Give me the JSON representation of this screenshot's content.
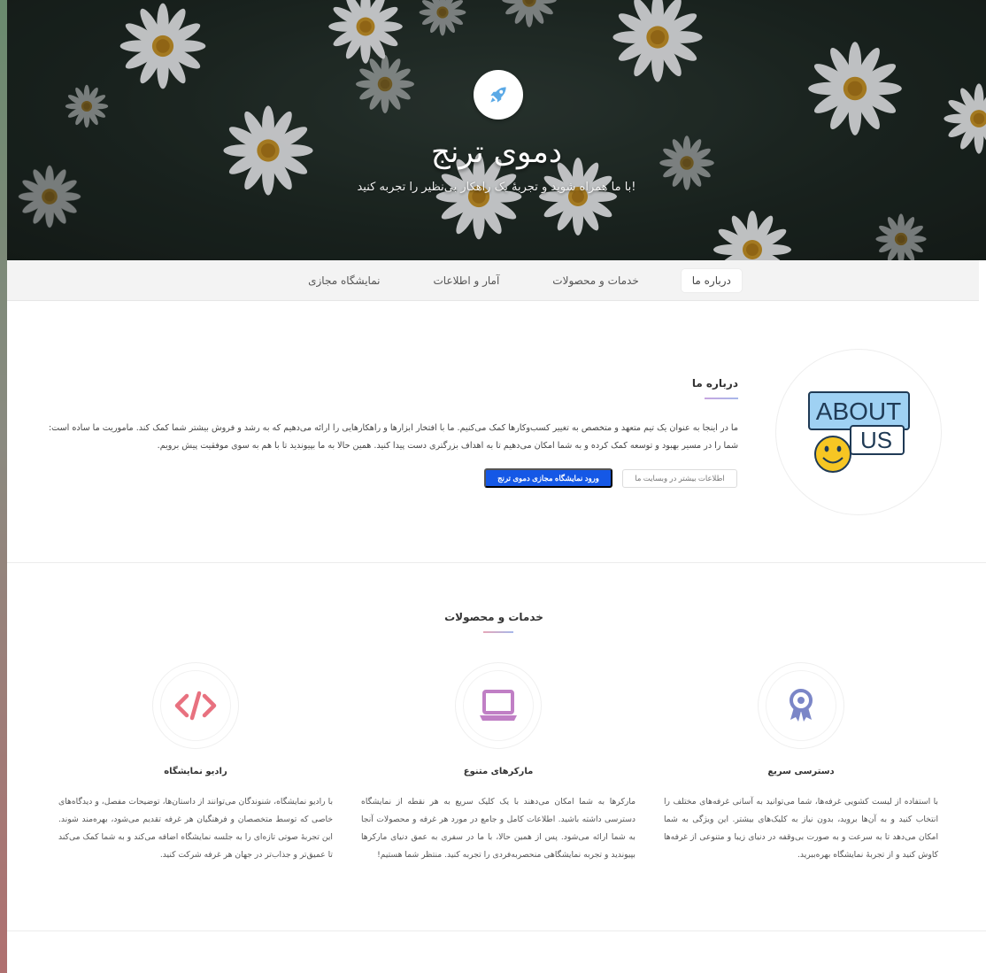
{
  "hero": {
    "title": "دموی ترنج",
    "subtitle": "!با ما همراه شوید و تجربهٔ یک راهکار بی‌نظیر را تجربه کنید",
    "logo_icon": "rocket-icon"
  },
  "nav": {
    "tabs": [
      {
        "label": "درباره ما",
        "active": true
      },
      {
        "label": "خدمات و محصولات",
        "active": false
      },
      {
        "label": "آمار و اطلاعات",
        "active": false
      },
      {
        "label": "نمایشگاه مجازی",
        "active": false
      }
    ]
  },
  "about": {
    "image_text_1": "ABOUT",
    "image_text_2": "US",
    "title": "درباره ما",
    "lines": [
      "ما در اینجا به عنوان یک تیم متعهد و متخصص به تغییر کسب‌وکارها کمک می‌کنیم. ما با افتخار ابزارها و راهکارهایی را ارائه می‌دهیم که به رشد و فروش بیشتر شما کمک کند. ماموریت ما ساده است:",
      "شما را در مسیر بهبود و توسعه کمک کرده و به شما امکان می‌دهیم تا به اهداف بزرگتری دست پیدا کنید. همین حالا به ما بپیوندید تا با هم به سوی موفقیت پیش برویم."
    ],
    "more_button": "اطلاعات بیشتر در وبسایت ما",
    "enter_button": "ورود نمایشگاه مجازی دموی ترنج"
  },
  "services": {
    "title": "خدمات و محصولات",
    "items": [
      {
        "icon": "award-icon",
        "title": "دسترسی سریع",
        "text": "با استفاده از لیست کشویی غرفه‌ها، شما می‌توانید به آسانی غرفه‌های مختلف را انتخاب کنید و به آن‌ها بروید، بدون نیاز به کلیک‌های بیشتر. این ویژگی به شما امکان می‌دهد تا به سرعت و به صورت بی‌وقفه در دنیای زیبا و متنوعی از غرفه‌ها کاوش کنید و از تجربهٔ نمایشگاه بهره‌ببرید."
      },
      {
        "icon": "laptop-icon",
        "title": "مارکرهای متنوع",
        "text": "مارکرها به شما امکان می‌دهند با یک کلیک سریع به هر نقطه از نمایشگاه دسترسی داشته باشید. اطلاعات کامل و جامع در مورد هر غرفه و محصولات آنجا به شما ارائه می‌شود. پس از همین حالا، با ما در سفری به عمق دنیای مارکرها بپیوندید و تجربه نمایشگاهی منحصربه‌فردی را تجربه کنید. منتظر شما هستیم!"
      },
      {
        "icon": "code-icon",
        "title": "رادیو نمایشگاه",
        "text": "با رادیو نمایشگاه، شنوندگان می‌توانند از داستان‌ها، توضیحات مفصل، و دیدگاه‌های خاصی که توسط متخصصان و فرهنگیان هر غرفه تقدیم می‌شود، بهره‌مند شوند. این تجربهٔ صوتی تازه‌ای را به جلسه نمایشگاه اضافه می‌کند و به شما کمک می‌کند تا عمیق‌تر و جذاب‌تر در جهان هر غرفه شرکت کنید."
      }
    ]
  },
  "colors": {
    "primary": "#1558e6",
    "code_icon": "#e8717f",
    "laptop_icon": "#c07fc5",
    "award_icon": "#7b86c7"
  }
}
